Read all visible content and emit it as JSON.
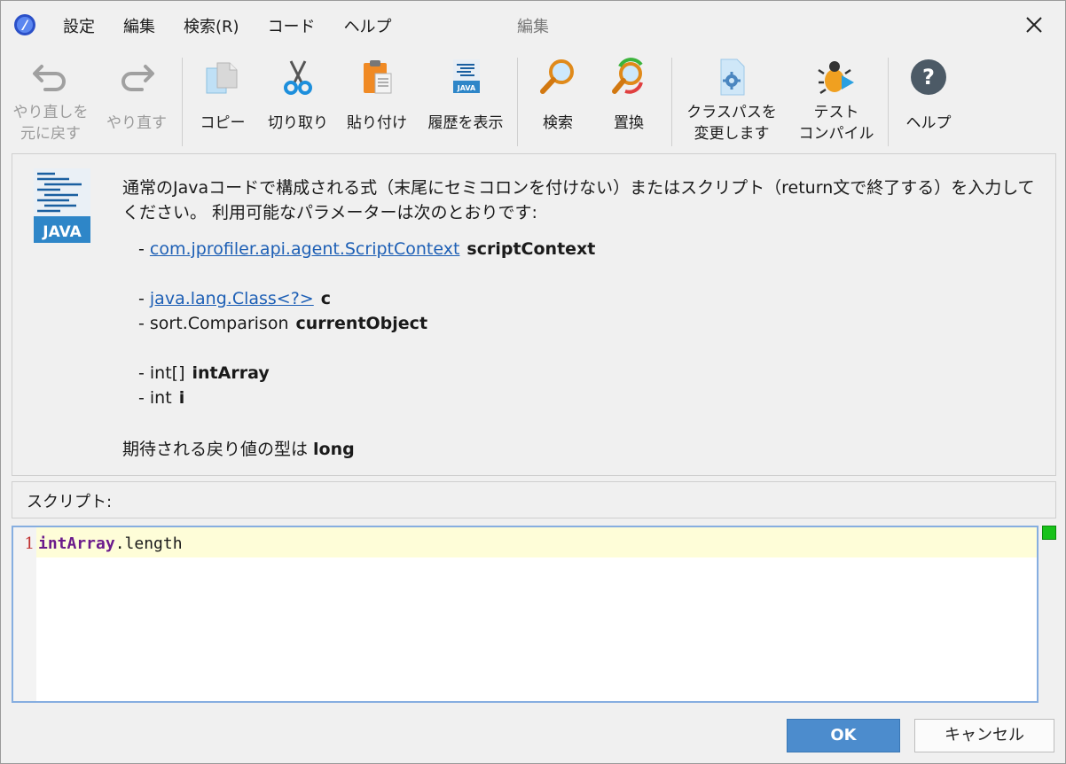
{
  "menu": [
    "設定",
    "編集",
    "検索(R)",
    "コード",
    "ヘルプ"
  ],
  "window_title": "編集",
  "toolbar": {
    "undo": [
      "やり直しを",
      "元に戻す"
    ],
    "redo": "やり直す",
    "copy": "コピー",
    "cut": "切り取り",
    "paste": "貼り付け",
    "history": "履歴を表示",
    "find": "検索",
    "replace": "置換",
    "classpath": [
      "クラスパスを",
      "変更します"
    ],
    "test_compile": [
      "テスト",
      "コンパイル"
    ],
    "help": "ヘルプ"
  },
  "info": {
    "logo_text": "JAVA",
    "description": "通常のJavaコードで構成される式（末尾にセミコロンを付けない）またはスクリプト（return文で終了する）を入力してください。 利用可能なパラメーターは次のとおりです:",
    "params": [
      {
        "prefix": "- ",
        "type": "com.jprofiler.api.agent.ScriptContext",
        "link": true,
        "name": "scriptContext"
      },
      {
        "prefix": "- ",
        "type": "java.lang.Class<?>",
        "link": true,
        "name": "c"
      },
      {
        "prefix": "- ",
        "type": "sort.Comparison",
        "link": false,
        "name": "currentObject"
      },
      {
        "prefix": "- ",
        "type": "int[]",
        "link": false,
        "name": "intArray"
      },
      {
        "prefix": "- ",
        "type": "int",
        "link": false,
        "name": "i"
      }
    ],
    "return_prefix": "期待される戻り値の型は ",
    "return_type": "long"
  },
  "script_label": "スクリプト:",
  "editor": {
    "line_number": "1",
    "code_keyword": "intArray",
    "code_rest": ".length"
  },
  "buttons": {
    "ok": "OK",
    "cancel": "キャンセル"
  },
  "colors": {
    "accent": "#4c8ccd",
    "link": "#1d5fb5",
    "status_ok": "#18c21a"
  }
}
